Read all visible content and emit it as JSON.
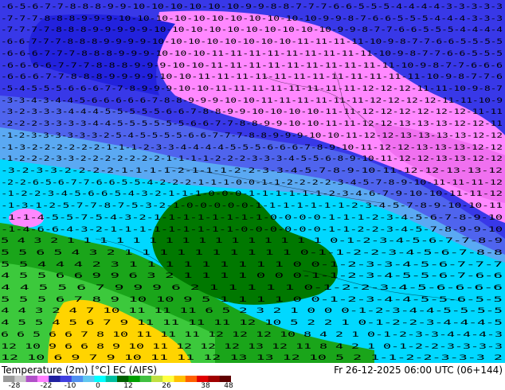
{
  "title": "Temperature (2m) [°C] EC (AIFS)",
  "valid_time": "Fr 26-12-2025 06:00 UTC (06+144)",
  "legend": {
    "ticks": [
      "-28",
      "-22",
      "-10",
      "0",
      "12",
      "26",
      "38",
      "48"
    ],
    "colors": [
      "#9a9a9a",
      "#c8c8c8",
      "#b050c8",
      "#ff80ff",
      "#2020a0",
      "#4040e0",
      "#5090f0",
      "#60c8f0",
      "#00ffff",
      "#00c0a0",
      "#006000",
      "#00a000",
      "#40c040",
      "#c0e040",
      "#ffff40",
      "#ffc000",
      "#ff6000",
      "#e00000",
      "#a00000",
      "#600000"
    ]
  },
  "colors": {
    "pink": "#ff88ff",
    "magenta": "#f070f0",
    "blue": "#2222dd",
    "mid_blue": "#4f64ee",
    "light_blue": "#5aa9f3",
    "cyan": "#00d8ff",
    "dark_green": "#007800",
    "green": "#1aa51a",
    "light_green": "#3cc93c",
    "yellow": "#ffd400",
    "orange": "#ffc400"
  },
  "label_rows": [
    "-6-5-6-7-7-8-8-8-9-9-10-10-10-10-10-10-9-9-8-8-7-7-7-6-6-5-5-5-4-4-4-4-3-3-3-3-3",
    "-7-7-7-8-8-8-9-9-9-10-10-10-10-10-10-10-10-10-10-10-9-9-8-7-6-6-5-5-5-4-4-4-3-3-3",
    "-7-7-7-7-8-8-8-9-9-9-9-9-10-10-10-10-10-10-10-10-10-10-9-9-8-7-7-6-6-5-5-5-4-4-4-4",
    "-6-6-7-7-7-8-8-8-9-9-9-9-10-10-10-10-10-10-10-10-11-11-11-11-10-9-8-7-7-6-6-5-5-5-5",
    "-6-6-6-7-7-7-8-8-8-9-9-9-10-10-10-11-11-11-11-11-11-11-11-11-10-9-8-7-7-6-6-5-5-5",
    "-6-6-6-6-7-7-7-8-8-8-9-9-9-10-10-11-11-11-11-11-11-11-11-11-11-10-9-8-7-7-6-6-6",
    "-6-6-6-7-7-8-8-8-9-9-9-9-10-10-11-11-11-11-11-11-11-11-11-11-11-11-10-9-8-7-7-6",
    "-5-4-5-5-5-6-6-6-7-7-8-9-9-9-10-10-11-11-11-11-11-11-11-11-12-12-12-11-11-10-9-8-7",
    "-3-3-4-3-4-4-5-6-6-6-6-6-7-8-8-9-9-9-10-10-11-11-11-11-11-11-12-12-12-12-11-11-10-9",
    "-3-2-3-3-3-4-4-4-5-5-5-5-5-6-6-7-8-8-9-9-10-10-10-10-11-11-12-12-12-12-12-12-11-11",
    "-2-2-2-3-3-3-3-4-4-5-5-5-5-5-5-6-6-7-7-8-8-9-9-10-10-11-11-12-12-13-13-13-12-12-11",
    "-1-2-3-3-3-3-3-3-2-5-4-5-5-5-5-6-6-7-7-7-8-8-9-9-9-10-10-11-12-12-13-13-13-13-12-12",
    "-1-3-2-2-2-2-2-2-1-1-1-2-3-3-4-4-4-4-5-5-5-6-6-6-7-8-9-10-11-12-12-13-13-13-12-12",
    "-1-2-2-2-3-3-2-2-2-2-2-2-2-1-1-1-1-2-2-2-3-3-3-4-5-5-6-8-9-10-11-12-12-13-13-12-12",
    "-3-2-3-3-2-2-2-2-1-1-1-1-2-1-1-1-2-2-3-3-4-5-7-8-9-10-11-12-12-13-13-12",
    "-2-2-6-5-6-7-7-6-6-5-5-4-2-2-2-1-1-1-0-0-1-1-2-2-2-2-3-4-5-7-8-9-10-11-11-11-12",
    "-1-2-2-3-4-5-6-6-5-4-3-2-1-1-1-0-0-0-1-1-1-1-1-1-2-3-4-6-7-9-10-10-11-11-12",
    "-1-3-1-2-5-7-7-8-7-5-3-2-1-0-0-0-0-0-1-1-1-1-1-1-1-2-3-4-5-7-8-9-10-10-11",
    "-1-1-4-5-5-7-5-4-3-2-1-1-1-1-1-1-1-1-0-0-0-0-1-1-1-2-3-4-5-6-7-8-9-10",
    "-1-4-6-6-4-3-2-1-1-1-1-1-1-1-1-1-0-0-0-0-0-0-1-1-2-2-3-4-5-7-8-9-9-10",
    "5 4 3 2 1 1 1 1 1 1 1 1 1 1 1 1 1 1 1 1 0-1-2-3-4-5-6-7-7-8-9",
    "5 5 6 5 4 3 2 1 1 1 1 1 1 1 1 1 1 0-1-1-2-2-3-4-5-6-7-8-8",
    "5 5 4 4 4 2 3 1 1 1 1 1 1 1 1 1 0 0-1-2-3-3-4-5-6-7-7-7",
    "4 5 5 6 6 9 9 6 3 2 1 1 1 1 0 0 0-1-1-2-3-4-5-5-6-7-6-6",
    "4 4 5 5 6 7 9 9 9 6 2 1 1 1 1 1 0-1-2-2-3-4-5-6-6-6-6",
    "5 5 5 6 7 8 9 10 10 9 5 1 1 1 1 0 0-1-2-3-4-4-5-5-6-5-5",
    "4 4 3 2 4 7 10 11 11 11 6 5 2 3 2 1 0 0 0-1-2-3-4-4-5-5-5-5",
    "4 5 5 4 5 6 7 9 11 11 11 11 12 10 5 2 2 1 0-1-2-2-3-4-4-4-5",
    "6 6 5 6 6 7 8 10 11 11 11 12 12 12 10 8 4 2 1 0-1-2-3-3-4-4-4-3",
    "12 10 9 6 6 8 9 10 11 12 12 12 13 12 11 8 4 2 1 0-1-2-2-3-3-3-3",
    "12 10 6 9 7 9 10 11 11 12 13 13 12 10 5 2 1-1-2-2-3-3-3 2"
  ]
}
